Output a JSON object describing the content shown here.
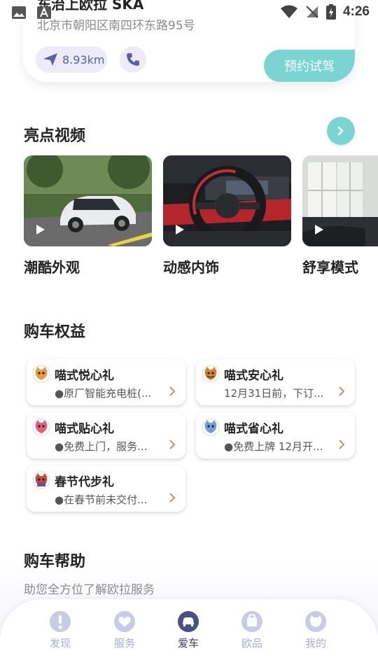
{
  "status_bar": {
    "time": "4:26"
  },
  "dealer": {
    "name": "东治上欧拉 SKA",
    "address": "北京市朝阳区南四环东路95号",
    "distance": "8.93km",
    "test_drive_label": "预约试驾"
  },
  "highlight_videos": {
    "title": "亮点视频",
    "items": [
      {
        "label": "潮酷外观"
      },
      {
        "label": "动感内饰"
      },
      {
        "label": "舒享模式"
      }
    ]
  },
  "benefits": {
    "title": "购车权益",
    "items": [
      {
        "title": "喵式悦心礼",
        "desc": "●原厂智能充电桩(..."
      },
      {
        "title": "喵式安心礼",
        "desc": "12月31日前，下订..."
      },
      {
        "title": "喵式贴心礼",
        "desc": "●免费上门，服务..."
      },
      {
        "title": "喵式省心礼",
        "desc": "●免费上牌 12月开..."
      },
      {
        "title": "春节代步礼",
        "desc": "●在春节前未交付..."
      }
    ]
  },
  "help": {
    "title": "购车帮助",
    "subtitle": "助您全方位了解欧拉服务"
  },
  "bottom_nav": {
    "items": [
      {
        "label": "发现",
        "icon": "discover-icon"
      },
      {
        "label": "服务",
        "icon": "service-icon"
      },
      {
        "label": "爱车",
        "icon": "car-icon",
        "active": true
      },
      {
        "label": "欧品",
        "icon": "shop-icon"
      },
      {
        "label": "我的",
        "icon": "profile-icon"
      }
    ]
  },
  "colors": {
    "accent": "#79d4d2",
    "nav_inactive": "#a9acd1",
    "nav_active": "#3c4076",
    "pill_bg": "#ecebf7"
  }
}
